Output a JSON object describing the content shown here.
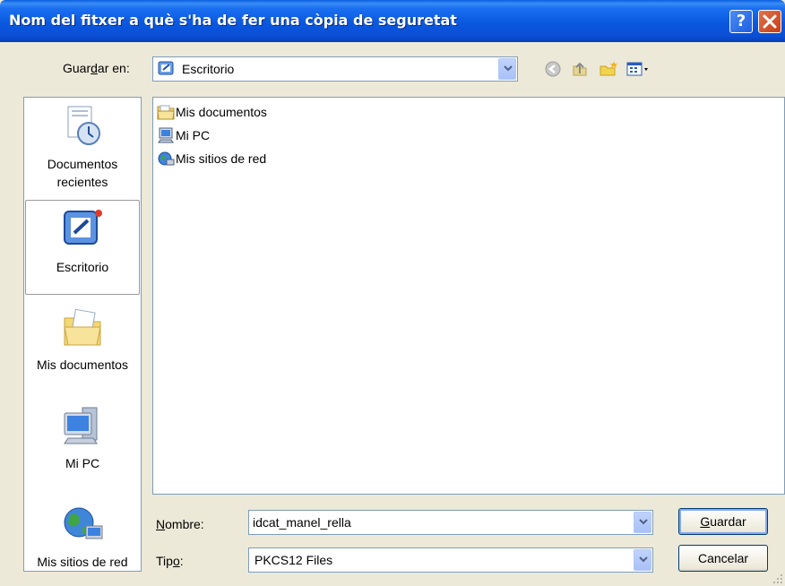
{
  "window": {
    "title": "Nom del fitxer a què s'ha de fer una còpia de seguretat",
    "help_label": "?",
    "close_label": "✕"
  },
  "save_in": {
    "label_pre": "Guar",
    "label_u": "d",
    "label_post": "ar en:",
    "value": "Escritorio"
  },
  "toolbar": {
    "icons": [
      "back-icon",
      "up-folder-icon",
      "new-folder-icon",
      "view-menu-icon"
    ]
  },
  "places": [
    {
      "label_line1": "Documentos",
      "label_line2": "recientes",
      "icon": "recent-documents-icon"
    },
    {
      "label_line1": "Escritorio",
      "label_line2": "",
      "icon": "desktop-icon"
    },
    {
      "label_line1": "Mis documentos",
      "label_line2": "",
      "icon": "my-documents-icon"
    },
    {
      "label_line1": "Mi PC",
      "label_line2": "",
      "icon": "my-computer-icon"
    },
    {
      "label_line1": "Mis sitios de red",
      "label_line2": "",
      "icon": "network-places-icon"
    }
  ],
  "files": [
    {
      "name": "Mis documentos",
      "icon": "folder-icon"
    },
    {
      "name": "Mi PC",
      "icon": "computer-icon"
    },
    {
      "name": "Mis sitios de red",
      "icon": "network-icon"
    }
  ],
  "filename": {
    "label_u": "N",
    "label_post": "ombre:",
    "value": "idcat_manel_rella"
  },
  "filetype": {
    "label_pre": "Tip",
    "label_u": "o",
    "label_post": ":",
    "value": "PKCS12 Files"
  },
  "buttons": {
    "save_u": "G",
    "save_post": "uardar",
    "cancel": "Cancelar"
  }
}
